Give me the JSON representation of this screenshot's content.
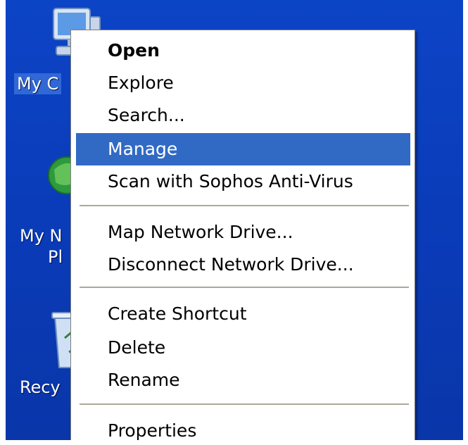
{
  "desktop": {
    "background_color": "#0a3dbb",
    "icons": [
      {
        "name": "computer-icon",
        "label_visible": "My C",
        "selected": true
      },
      {
        "name": "network-places-icon",
        "label_line1": "My N",
        "label_line2": "Pl"
      },
      {
        "name": "recycle-bin-icon",
        "label_visible": "Recy"
      }
    ]
  },
  "context_menu": {
    "highlight_color": "#316ac5",
    "items": {
      "open": "Open",
      "explore": "Explore",
      "search": "Search...",
      "manage": "Manage",
      "scan": "Scan with Sophos Anti-Virus",
      "map_drive": "Map Network Drive...",
      "disconnect_drive": "Disconnect Network Drive...",
      "create_shortcut": "Create Shortcut",
      "delete": "Delete",
      "rename": "Rename",
      "properties": "Properties"
    },
    "highlighted_item": "Manage",
    "default_item": "Open"
  }
}
